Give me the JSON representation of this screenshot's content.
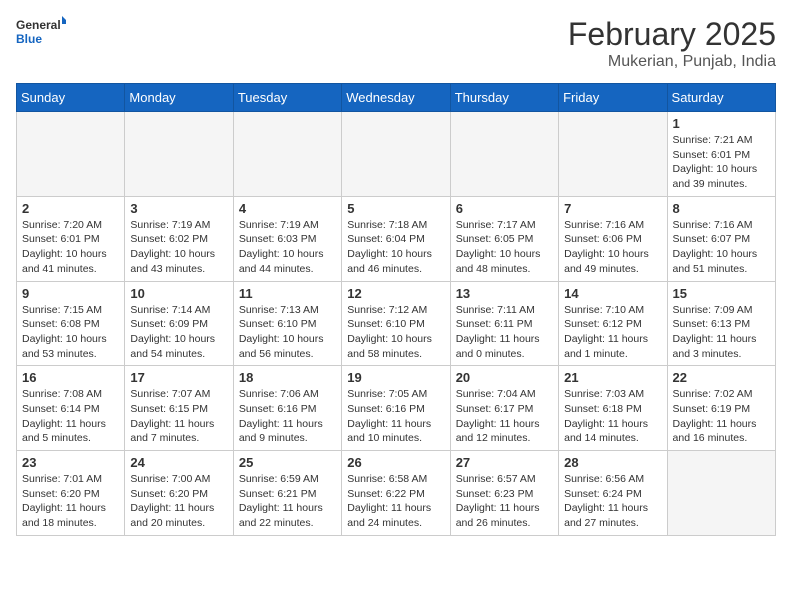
{
  "header": {
    "logo_general": "General",
    "logo_blue": "Blue",
    "month_year": "February 2025",
    "location": "Mukerian, Punjab, India"
  },
  "weekdays": [
    "Sunday",
    "Monday",
    "Tuesday",
    "Wednesday",
    "Thursday",
    "Friday",
    "Saturday"
  ],
  "weeks": [
    [
      {
        "day": "",
        "info": ""
      },
      {
        "day": "",
        "info": ""
      },
      {
        "day": "",
        "info": ""
      },
      {
        "day": "",
        "info": ""
      },
      {
        "day": "",
        "info": ""
      },
      {
        "day": "",
        "info": ""
      },
      {
        "day": "1",
        "info": "Sunrise: 7:21 AM\nSunset: 6:01 PM\nDaylight: 10 hours\nand 39 minutes."
      }
    ],
    [
      {
        "day": "2",
        "info": "Sunrise: 7:20 AM\nSunset: 6:01 PM\nDaylight: 10 hours\nand 41 minutes."
      },
      {
        "day": "3",
        "info": "Sunrise: 7:19 AM\nSunset: 6:02 PM\nDaylight: 10 hours\nand 43 minutes."
      },
      {
        "day": "4",
        "info": "Sunrise: 7:19 AM\nSunset: 6:03 PM\nDaylight: 10 hours\nand 44 minutes."
      },
      {
        "day": "5",
        "info": "Sunrise: 7:18 AM\nSunset: 6:04 PM\nDaylight: 10 hours\nand 46 minutes."
      },
      {
        "day": "6",
        "info": "Sunrise: 7:17 AM\nSunset: 6:05 PM\nDaylight: 10 hours\nand 48 minutes."
      },
      {
        "day": "7",
        "info": "Sunrise: 7:16 AM\nSunset: 6:06 PM\nDaylight: 10 hours\nand 49 minutes."
      },
      {
        "day": "8",
        "info": "Sunrise: 7:16 AM\nSunset: 6:07 PM\nDaylight: 10 hours\nand 51 minutes."
      }
    ],
    [
      {
        "day": "9",
        "info": "Sunrise: 7:15 AM\nSunset: 6:08 PM\nDaylight: 10 hours\nand 53 minutes."
      },
      {
        "day": "10",
        "info": "Sunrise: 7:14 AM\nSunset: 6:09 PM\nDaylight: 10 hours\nand 54 minutes."
      },
      {
        "day": "11",
        "info": "Sunrise: 7:13 AM\nSunset: 6:10 PM\nDaylight: 10 hours\nand 56 minutes."
      },
      {
        "day": "12",
        "info": "Sunrise: 7:12 AM\nSunset: 6:10 PM\nDaylight: 10 hours\nand 58 minutes."
      },
      {
        "day": "13",
        "info": "Sunrise: 7:11 AM\nSunset: 6:11 PM\nDaylight: 11 hours\nand 0 minutes."
      },
      {
        "day": "14",
        "info": "Sunrise: 7:10 AM\nSunset: 6:12 PM\nDaylight: 11 hours\nand 1 minute."
      },
      {
        "day": "15",
        "info": "Sunrise: 7:09 AM\nSunset: 6:13 PM\nDaylight: 11 hours\nand 3 minutes."
      }
    ],
    [
      {
        "day": "16",
        "info": "Sunrise: 7:08 AM\nSunset: 6:14 PM\nDaylight: 11 hours\nand 5 minutes."
      },
      {
        "day": "17",
        "info": "Sunrise: 7:07 AM\nSunset: 6:15 PM\nDaylight: 11 hours\nand 7 minutes."
      },
      {
        "day": "18",
        "info": "Sunrise: 7:06 AM\nSunset: 6:16 PM\nDaylight: 11 hours\nand 9 minutes."
      },
      {
        "day": "19",
        "info": "Sunrise: 7:05 AM\nSunset: 6:16 PM\nDaylight: 11 hours\nand 10 minutes."
      },
      {
        "day": "20",
        "info": "Sunrise: 7:04 AM\nSunset: 6:17 PM\nDaylight: 11 hours\nand 12 minutes."
      },
      {
        "day": "21",
        "info": "Sunrise: 7:03 AM\nSunset: 6:18 PM\nDaylight: 11 hours\nand 14 minutes."
      },
      {
        "day": "22",
        "info": "Sunrise: 7:02 AM\nSunset: 6:19 PM\nDaylight: 11 hours\nand 16 minutes."
      }
    ],
    [
      {
        "day": "23",
        "info": "Sunrise: 7:01 AM\nSunset: 6:20 PM\nDaylight: 11 hours\nand 18 minutes."
      },
      {
        "day": "24",
        "info": "Sunrise: 7:00 AM\nSunset: 6:20 PM\nDaylight: 11 hours\nand 20 minutes."
      },
      {
        "day": "25",
        "info": "Sunrise: 6:59 AM\nSunset: 6:21 PM\nDaylight: 11 hours\nand 22 minutes."
      },
      {
        "day": "26",
        "info": "Sunrise: 6:58 AM\nSunset: 6:22 PM\nDaylight: 11 hours\nand 24 minutes."
      },
      {
        "day": "27",
        "info": "Sunrise: 6:57 AM\nSunset: 6:23 PM\nDaylight: 11 hours\nand 26 minutes."
      },
      {
        "day": "28",
        "info": "Sunrise: 6:56 AM\nSunset: 6:24 PM\nDaylight: 11 hours\nand 27 minutes."
      },
      {
        "day": "",
        "info": ""
      }
    ]
  ]
}
